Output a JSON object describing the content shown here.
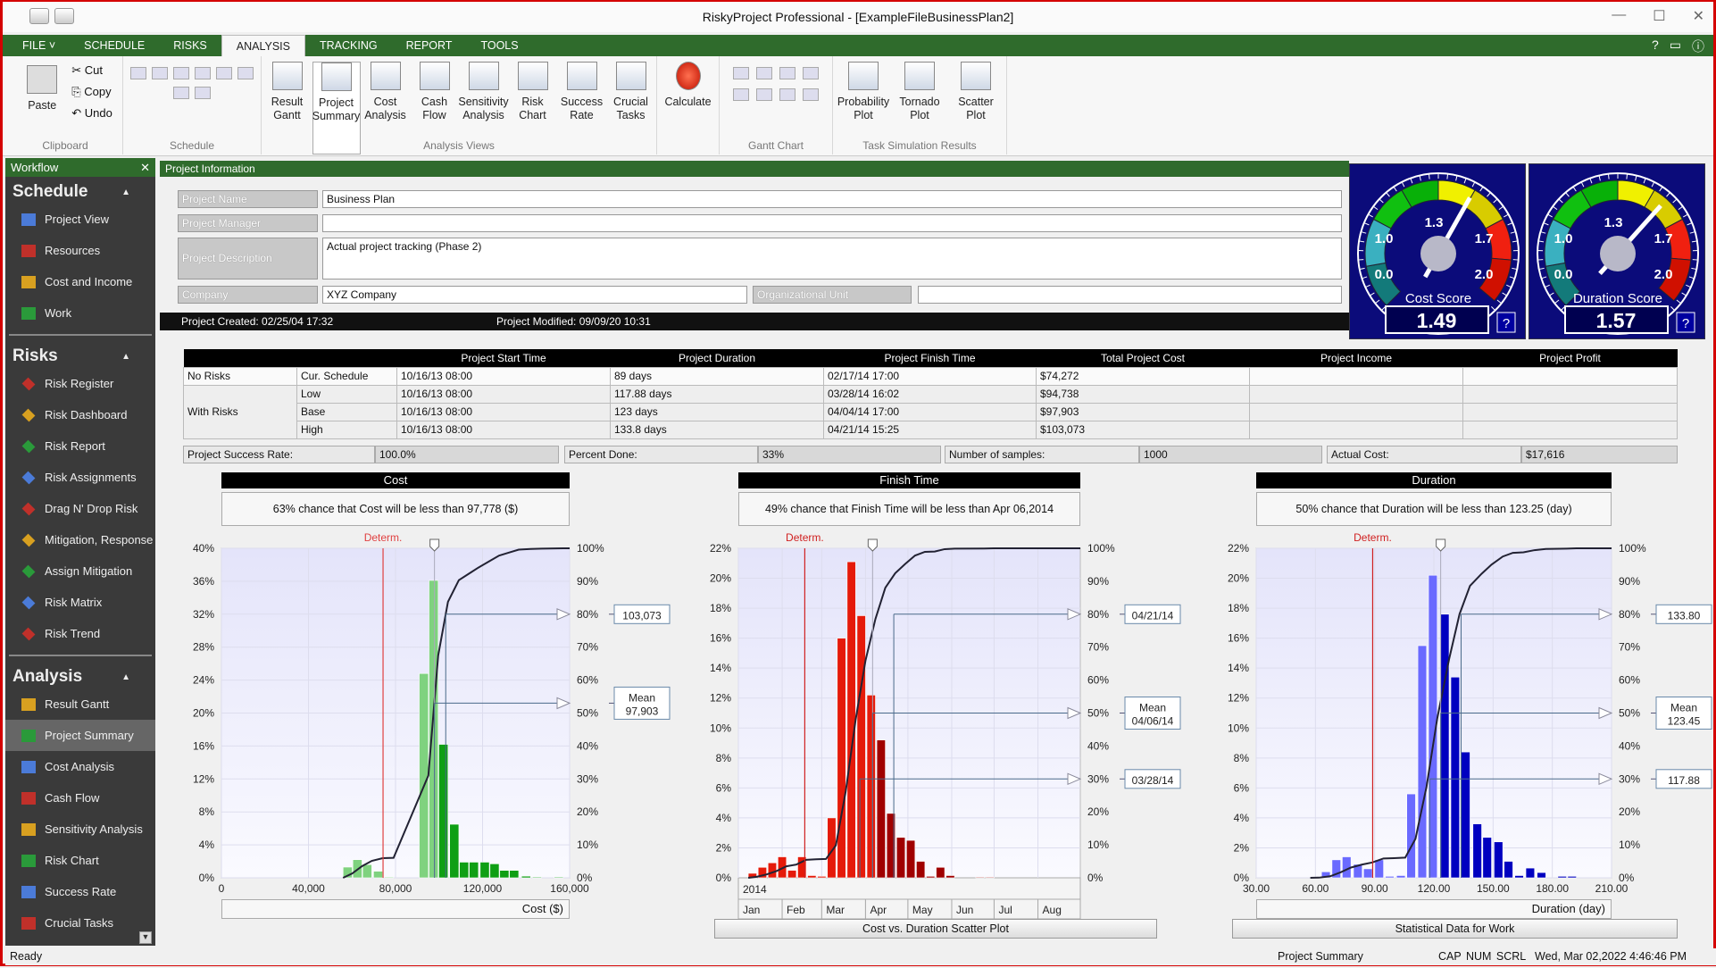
{
  "window": {
    "title": "RiskyProject Professional - [ExampleFileBusinessPlan2]",
    "minimize": "—",
    "maximize": "☐",
    "close": "✕"
  },
  "menu": {
    "tabs": [
      "FILE ˅",
      "SCHEDULE",
      "RISKS",
      "ANALYSIS",
      "TRACKING",
      "REPORT",
      "TOOLS"
    ],
    "active": "ANALYSIS",
    "help": "?"
  },
  "ribbon": {
    "clipboard": {
      "label": "Clipboard",
      "paste": "Paste",
      "cut": "Cut",
      "copy": "Copy",
      "undo": "Undo"
    },
    "schedule": {
      "label": "Schedule"
    },
    "analysis_views": {
      "label": "Analysis Views",
      "buttons": [
        "Result Gantt",
        "Project Summary",
        "Cost Analysis",
        "Cash Flow",
        "Sensitivity Analysis",
        "Risk Chart",
        "Success Rate",
        "Crucial Tasks"
      ],
      "selected": "Project Summary"
    },
    "calculate": {
      "label": "Calculate"
    },
    "gantt": {
      "label": "Gantt Chart"
    },
    "task_sim": {
      "label": "Task Simulation Results",
      "buttons": [
        "Probability Plot",
        "Tornado Plot",
        "Scatter Plot"
      ]
    }
  },
  "sidebar": {
    "title": "Workflow",
    "sections": [
      {
        "title": "Schedule",
        "items": [
          "Project View",
          "Resources",
          "Cost and Income",
          "Work"
        ]
      },
      {
        "title": "Risks",
        "items": [
          "Risk Register",
          "Risk Dashboard",
          "Risk Report",
          "Risk Assignments",
          "Drag N' Drop Risk",
          "Mitigation, Response",
          "Assign Mitigation",
          "Risk Matrix",
          "Risk Trend"
        ]
      },
      {
        "title": "Analysis",
        "items": [
          "Result Gantt",
          "Project Summary",
          "Cost Analysis",
          "Cash Flow",
          "Sensitivity Analysis",
          "Risk Chart",
          "Success Rate",
          "Crucial Tasks"
        ]
      }
    ],
    "selected": "Project Summary"
  },
  "project_info": {
    "header": "Project Information",
    "name_label": "Project Name",
    "name": "Business Plan",
    "manager_label": "Project Manager",
    "manager": "",
    "description_label": "Project Description",
    "description": "Actual project tracking (Phase 2)",
    "company_label": "Company",
    "company": "XYZ Company",
    "org_unit_label": "Organizational Unit",
    "org_unit": "",
    "created": "Project Created: 02/25/04 17:32",
    "modified": "Project Modified: 09/09/20 10:31"
  },
  "gauges": [
    {
      "title": "Cost Score",
      "value": 1.49,
      "display": "1.49",
      "labels": [
        "0.0",
        "1.0",
        "1.3",
        "1.7",
        "2.0"
      ],
      "help": "?"
    },
    {
      "title": "Duration Score",
      "value": 1.57,
      "display": "1.57",
      "labels": [
        "0.0",
        "1.0",
        "1.3",
        "1.7",
        "2.0"
      ],
      "help": "?"
    }
  ],
  "summary_table": {
    "headers": [
      "",
      "",
      "Project Start Time",
      "Project Duration",
      "Project Finish Time",
      "Total Project Cost",
      "Project Income",
      "Project Profit"
    ],
    "no_risks": {
      "label": "No Risks",
      "row": [
        "Cur. Schedule",
        "10/16/13 08:00",
        "89 days",
        "02/17/14 17:00",
        "$74,272",
        "",
        ""
      ]
    },
    "with_risks": {
      "label": "With Risks",
      "rows": [
        [
          "Low",
          "10/16/13 08:00",
          "117.88 days",
          "03/28/14 16:02",
          "$94,738",
          "",
          ""
        ],
        [
          "Base",
          "10/16/13 08:00",
          "123 days",
          "04/04/14 17:00",
          "$97,903",
          "",
          ""
        ],
        [
          "High",
          "10/16/13 08:00",
          "133.8 days",
          "04/21/14 15:25",
          "$103,073",
          "",
          ""
        ]
      ]
    }
  },
  "stats": [
    {
      "label": "Project Success Rate:",
      "value": "100.0%"
    },
    {
      "label": "Percent Done:",
      "value": "33%"
    },
    {
      "label": "Number of samples:",
      "value": "1000"
    },
    {
      "label": "Actual Cost:",
      "value": "$17,616"
    }
  ],
  "buttons": {
    "scatter": "Cost vs. Duration Scatter Plot",
    "statistical": "Statistical Data for Work"
  },
  "status": {
    "left": "Ready",
    "view": "Project Summary",
    "keys": "CAP  NUM  SCRL",
    "datetime": "Wed, Mar 02,2022  4:46:46 PM"
  },
  "chart_data": [
    {
      "type": "bar",
      "title": "Cost",
      "info": "63% chance that Cost will be less than 97,778 ($)",
      "xlabel": "Cost ($)",
      "xlim": [
        0,
        160000
      ],
      "ylim": [
        0,
        40
      ],
      "y2lim": [
        0,
        100
      ],
      "grid": true,
      "xticks": [
        0,
        40000,
        80000,
        120000,
        160000
      ],
      "xtick_labels": [
        "0",
        "40,000",
        "80,000",
        "120,000",
        "160,000"
      ],
      "yticks": [
        0,
        4,
        8,
        12,
        16,
        20,
        24,
        28,
        32,
        36,
        40
      ],
      "ytick_labels": [
        "0%",
        "4%",
        "8%",
        "12%",
        "16%",
        "20%",
        "24%",
        "28%",
        "32%",
        "36%",
        "40%"
      ],
      "y2ticks": [
        0,
        10,
        20,
        30,
        40,
        50,
        60,
        70,
        80,
        90,
        100
      ],
      "y2tick_labels": [
        "0%",
        "10%",
        "20%",
        "30%",
        "40%",
        "50%",
        "60%",
        "70%",
        "80%",
        "90%",
        "100%"
      ],
      "bin_width": 4200,
      "bins": [
        [
          58000,
          1.3
        ],
        [
          62500,
          2.2
        ],
        [
          67000,
          1.6
        ],
        [
          72000,
          0.8
        ],
        [
          77000,
          0.1
        ],
        [
          93000,
          24.8
        ],
        [
          97500,
          36.1
        ],
        [
          102000,
          16.2
        ],
        [
          107000,
          6.5
        ],
        [
          111500,
          1.9
        ],
        [
          116000,
          1.9
        ],
        [
          121000,
          1.9
        ],
        [
          125500,
          1.7
        ],
        [
          130000,
          0.9
        ],
        [
          134500,
          0.9
        ],
        [
          140000,
          0.2
        ],
        [
          145000,
          0.1
        ],
        [
          155000,
          0.1
        ]
      ],
      "determ": {
        "label": "Determ.",
        "x": 74272
      },
      "mean": 97903,
      "markers": [
        {
          "level": 80,
          "x": 103073,
          "label": [
            "103,073"
          ]
        },
        {
          "level": 53,
          "x": 97903,
          "label": [
            "Mean",
            "97,903"
          ]
        }
      ],
      "colors": {
        "light": "#7fd27f",
        "dark": "#0f9f14",
        "determ": "#e04040"
      }
    },
    {
      "type": "bar",
      "title": "Finish Time",
      "info": "49% chance that Finish Time will be less than Apr 06,2014",
      "xlabel": "",
      "xlim": [
        "2014-01-01",
        "2014-08-31"
      ],
      "ylim": [
        0,
        22
      ],
      "y2lim": [
        0,
        100
      ],
      "grid": true,
      "year_label": "2014",
      "months": [
        "Jan",
        "Feb",
        "Mar",
        "Apr",
        "May",
        "Jun",
        "Jul",
        "Aug"
      ],
      "yticks": [
        0,
        2,
        4,
        6,
        8,
        10,
        12,
        14,
        16,
        18,
        20,
        22
      ],
      "ytick_labels": [
        "0%",
        "2%",
        "4%",
        "6%",
        "8%",
        "10%",
        "12%",
        "14%",
        "16%",
        "18%",
        "20%",
        "22%"
      ],
      "y2ticks": [
        0,
        10,
        20,
        30,
        40,
        50,
        60,
        70,
        80,
        90,
        100
      ],
      "y2tick_labels": [
        "0%",
        "10%",
        "20%",
        "30%",
        "40%",
        "50%",
        "60%",
        "70%",
        "80%",
        "90%",
        "100%"
      ],
      "bin_days": 6,
      "bins": [
        [
          "2014-01-11",
          0.3
        ],
        [
          "2014-01-18",
          0.7
        ],
        [
          "2014-01-25",
          1.0
        ],
        [
          "2014-02-01",
          1.4
        ],
        [
          "2014-02-08",
          0.5
        ],
        [
          "2014-02-15",
          1.4
        ],
        [
          "2014-02-22",
          0.15
        ],
        [
          "2014-03-01",
          0.1
        ],
        [
          "2014-03-08",
          4.0
        ],
        [
          "2014-03-15",
          16.0
        ],
        [
          "2014-03-22",
          21.1
        ],
        [
          "2014-03-29",
          17.5
        ],
        [
          "2014-04-05",
          12.2
        ],
        [
          "2014-04-12",
          9.2
        ],
        [
          "2014-04-19",
          4.3
        ],
        [
          "2014-04-26",
          2.7
        ],
        [
          "2014-05-03",
          2.5
        ],
        [
          "2014-05-10",
          1.1
        ],
        [
          "2014-05-17",
          0.1
        ],
        [
          "2014-05-24",
          0.7
        ],
        [
          "2014-05-31",
          0.15
        ],
        [
          "2014-06-21",
          0.05
        ],
        [
          "2014-06-28",
          0.05
        ]
      ],
      "determ": {
        "label": "Determ.",
        "x": "2014-02-17"
      },
      "mean": "2014-04-06",
      "markers": [
        {
          "level": 80,
          "x": "2014-04-21",
          "label": [
            "04/21/14"
          ]
        },
        {
          "level": 50,
          "x": "2014-04-06",
          "label": [
            "Mean",
            "04/06/14"
          ]
        },
        {
          "level": 30,
          "x": "2014-03-28",
          "label": [
            "03/28/14"
          ]
        }
      ],
      "colors": {
        "light": "#e51a0a",
        "dark": "#a00000",
        "determ": "#d02020"
      }
    },
    {
      "type": "bar",
      "title": "Duration",
      "info": "50% chance that Duration will be less than 123.25 (day)",
      "xlabel": "Duration (day)",
      "xlim": [
        30,
        210
      ],
      "ylim": [
        0,
        22
      ],
      "y2lim": [
        0,
        100
      ],
      "grid": true,
      "xticks": [
        30,
        60,
        90,
        120,
        150,
        180,
        210
      ],
      "xtick_labels": [
        "30.00",
        "60.00",
        "90.00",
        "120.00",
        "150.00",
        "180.00",
        "210.00"
      ],
      "yticks": [
        0,
        2,
        4,
        6,
        8,
        10,
        12,
        14,
        16,
        18,
        20,
        22
      ],
      "ytick_labels": [
        "0%",
        "2%",
        "4%",
        "6%",
        "8%",
        "10%",
        "12%",
        "14%",
        "16%",
        "18%",
        "20%",
        "22%"
      ],
      "y2ticks": [
        0,
        10,
        20,
        30,
        40,
        50,
        60,
        70,
        80,
        90,
        100
      ],
      "y2tick_labels": [
        "0%",
        "10%",
        "20%",
        "30%",
        "40%",
        "50%",
        "60%",
        "70%",
        "80%",
        "90%",
        "100%"
      ],
      "bin_width": 4.4,
      "bins": [
        [
          59.6,
          0.05
        ],
        [
          65.3,
          0.4
        ],
        [
          70.6,
          1.2
        ],
        [
          75.8,
          1.4
        ],
        [
          81.5,
          0.9
        ],
        [
          86.6,
          0.6
        ],
        [
          92.3,
          1.2
        ],
        [
          97.6,
          0.1
        ],
        [
          103.3,
          0.15
        ],
        [
          108.5,
          5.6
        ],
        [
          114.1,
          15.5
        ],
        [
          119.5,
          20.2
        ],
        [
          125.5,
          17.6
        ],
        [
          130.8,
          13.4
        ],
        [
          136.1,
          8.4
        ],
        [
          142,
          3.6
        ],
        [
          147,
          2.7
        ],
        [
          152.7,
          2.4
        ],
        [
          157.8,
          1.1
        ],
        [
          163.2,
          0.15
        ],
        [
          168.8,
          0.65
        ],
        [
          174.5,
          0.35
        ],
        [
          185,
          0.1
        ],
        [
          190,
          0.1
        ]
      ],
      "determ": {
        "label": "Determ.",
        "x": 89
      },
      "mean": 123.45,
      "markers": [
        {
          "level": 80,
          "x": 133.8,
          "label": [
            "133.80"
          ]
        },
        {
          "level": 50,
          "x": 123.45,
          "label": [
            "Mean",
            "123.45"
          ]
        },
        {
          "level": 30,
          "x": 117.88,
          "label": [
            "117.88"
          ]
        }
      ],
      "colors": {
        "light": "#6a6aff",
        "dark": "#0000c0",
        "determ": "#d02020"
      }
    }
  ]
}
